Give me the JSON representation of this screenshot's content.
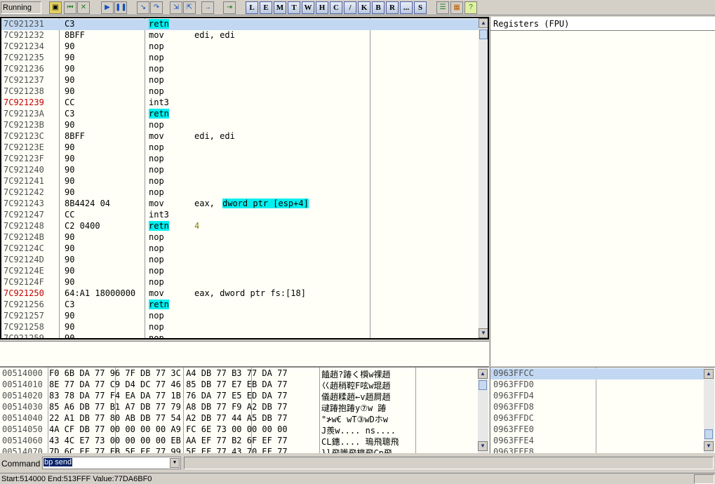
{
  "toolbar": {
    "status": "Running",
    "letter_buttons": [
      "L",
      "E",
      "M",
      "T",
      "W",
      "H",
      "C",
      "/",
      "K",
      "B",
      "R",
      "...",
      "S"
    ]
  },
  "disasm": {
    "rows": [
      {
        "addr": "7C921231",
        "hex": "C3",
        "mn": "retn",
        "op": "",
        "sel": true,
        "red": false,
        "mn_hl": true,
        "op_hl": false,
        "op_num": false
      },
      {
        "addr": "7C921232",
        "hex": "8BFF",
        "mn": "mov",
        "op": "edi, edi",
        "red": false,
        "mn_hl": false,
        "op_hl": false,
        "op_num": false
      },
      {
        "addr": "7C921234",
        "hex": "90",
        "mn": "nop",
        "op": "",
        "red": false
      },
      {
        "addr": "7C921235",
        "hex": "90",
        "mn": "nop",
        "op": "",
        "red": false
      },
      {
        "addr": "7C921236",
        "hex": "90",
        "mn": "nop",
        "op": "",
        "red": false
      },
      {
        "addr": "7C921237",
        "hex": "90",
        "mn": "nop",
        "op": "",
        "red": false
      },
      {
        "addr": "7C921238",
        "hex": "90",
        "mn": "nop",
        "op": "",
        "red": false
      },
      {
        "addr": "7C921239",
        "hex": "CC",
        "mn": "int3",
        "op": "",
        "red": true
      },
      {
        "addr": "7C92123A",
        "hex": "C3",
        "mn": "retn",
        "op": "",
        "red": false,
        "mn_hl": true
      },
      {
        "addr": "7C92123B",
        "hex": "90",
        "mn": "nop",
        "op": "",
        "red": false
      },
      {
        "addr": "7C92123C",
        "hex": "8BFF",
        "mn": "mov",
        "op": "edi, edi",
        "red": false
      },
      {
        "addr": "7C92123E",
        "hex": "90",
        "mn": "nop",
        "op": "",
        "red": false
      },
      {
        "addr": "7C92123F",
        "hex": "90",
        "mn": "nop",
        "op": "",
        "red": false
      },
      {
        "addr": "7C921240",
        "hex": "90",
        "mn": "nop",
        "op": "",
        "red": false
      },
      {
        "addr": "7C921241",
        "hex": "90",
        "mn": "nop",
        "op": "",
        "red": false
      },
      {
        "addr": "7C921242",
        "hex": "90",
        "mn": "nop",
        "op": "",
        "red": false
      },
      {
        "addr": "7C921243",
        "hex": "8B4424 04",
        "mn": "mov",
        "op": "eax,",
        "op2": "dword ptr [esp+4]",
        "red": false
      },
      {
        "addr": "7C921247",
        "hex": "CC",
        "mn": "int3",
        "op": "",
        "red": false
      },
      {
        "addr": "7C921248",
        "hex": "C2 0400",
        "mn": "retn",
        "op": "4",
        "red": false,
        "mn_hl": true,
        "op_num": true
      },
      {
        "addr": "7C92124B",
        "hex": "90",
        "mn": "nop",
        "op": "",
        "red": false
      },
      {
        "addr": "7C92124C",
        "hex": "90",
        "mn": "nop",
        "op": "",
        "red": false
      },
      {
        "addr": "7C92124D",
        "hex": "90",
        "mn": "nop",
        "op": "",
        "red": false
      },
      {
        "addr": "7C92124E",
        "hex": "90",
        "mn": "nop",
        "op": "",
        "red": false
      },
      {
        "addr": "7C92124F",
        "hex": "90",
        "mn": "nop",
        "op": "",
        "red": false
      },
      {
        "addr": "7C921250",
        "hex": "64:A1 18000000",
        "mn": "mov",
        "op": "eax, dword ptr fs:[18]",
        "red": true
      },
      {
        "addr": "7C921256",
        "hex": "C3",
        "mn": "retn",
        "op": "",
        "red": false,
        "mn_hl": true
      },
      {
        "addr": "7C921257",
        "hex": "90",
        "mn": "nop",
        "op": "",
        "red": false
      },
      {
        "addr": "7C921258",
        "hex": "90",
        "mn": "nop",
        "op": "",
        "red": false
      },
      {
        "addr": "7C921259",
        "hex": "90",
        "mn": "nop",
        "op": "",
        "red": false
      }
    ]
  },
  "registers": {
    "title": "Registers (FPU)"
  },
  "dump": {
    "rows": [
      {
        "addr": "00514000",
        "bytes": "F0 6B DA 77|96 7F DB 77|3C A4 DB 77|B3 77 DA 77",
        "ascii": "饁趙?踳く櫍w祼趙"
      },
      {
        "addr": "00514010",
        "bytes": "8E 77 DA 77|C9 D4 DC 77|46 85 DB 77|E7 EB DA 77",
        "ascii": "巜趙稍鞚F呟w琨趙"
      },
      {
        "addr": "00514020",
        "bytes": "83 78 DA 77|F4 EA DA 77|1B 76 DA 77|E5 ED DA 77",
        "ascii": "儀趙糅趙←v趙屙趙"
      },
      {
        "addr": "00514030",
        "bytes": "85 A6 DB 77|B1 A7 DB 77|79 A8 DB 77|F9 A2 DB 77",
        "ascii": "叇踳抱踳y⑦w 踳"
      },
      {
        "addr": "00514040",
        "bytes": "22 A1 DB 77|80 AB DB 77|54 A2 DB 77|44 A5 DB 77",
        "ascii": "\"≯w€ wT③wDホw"
      },
      {
        "addr": "00514050",
        "bytes": "4A CF DB 77|00 00 00 00|A9 FC 6E 73|00 00 00 00",
        "ascii": "J羨w....  ns...."
      },
      {
        "addr": "00514060",
        "bytes": "43 4C E7 73|00 00 00 00|EB AA EF 77|B2 6F EF 77",
        "ascii": "CL鏸....  瑦飛聰飛"
      },
      {
        "addr": "00514070",
        "bytes": "7D 6C EF 77|EB 5E EF 77|99 5F EF 77|43 70 EF 77",
        "ascii": "}l飛隵飛檁飛Cp飛"
      }
    ]
  },
  "stack": {
    "rows": [
      "0963FFCC",
      "0963FFD0",
      "0963FFD4",
      "0963FFD8",
      "0963FFDC",
      "0963FFE0",
      "0963FFE4",
      "0963FFE8"
    ]
  },
  "command": {
    "label": "Command",
    "value": "bp send"
  },
  "status_bar": {
    "text": "Start:514000 End:513FFF Value:77DA6BF0"
  }
}
